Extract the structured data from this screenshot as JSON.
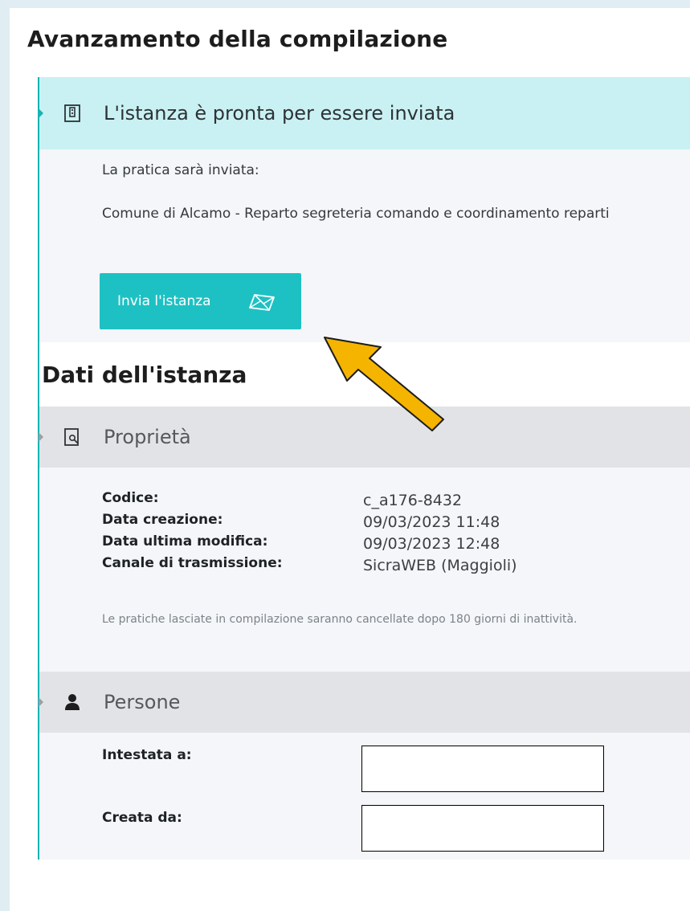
{
  "progress": {
    "title": "Avanzamento della compilazione",
    "status_header": "L'istanza è pronta per essere inviata",
    "status_icon": "door-icon",
    "send_info_label": "La pratica sarà inviata:",
    "recipient": "Comune di Alcamo - Reparto segreteria comando e coordinamento reparti",
    "send_button_label": "Invia l'istanza",
    "send_button_icon": "envelope-icon"
  },
  "instance": {
    "title": "Dati dell'istanza",
    "properties": {
      "header": "Proprietà",
      "header_icon": "document-search-icon",
      "fields": [
        {
          "key": "Codice:",
          "value": "c_a176-8432"
        },
        {
          "key": "Data creazione:",
          "value": "09/03/2023 11:48"
        },
        {
          "key": "Data ultima modifica:",
          "value": "09/03/2023 12:48"
        },
        {
          "key": "Canale di trasmissione:",
          "value": "SicraWEB (Maggioli)"
        }
      ],
      "note": "Le pratiche lasciate in compilazione saranno cancellate dopo 180 giorni di inattività."
    },
    "people": {
      "header": "Persone",
      "header_icon": "person-icon",
      "fields": [
        {
          "key": "Intestata a:"
        },
        {
          "key": "Creata da:"
        }
      ]
    }
  },
  "colors": {
    "accent": "#1ec1c3",
    "teal_header": "#c9f1f3",
    "gray_header": "#e1e3e6",
    "annotation_arrow": "#f5b400"
  }
}
